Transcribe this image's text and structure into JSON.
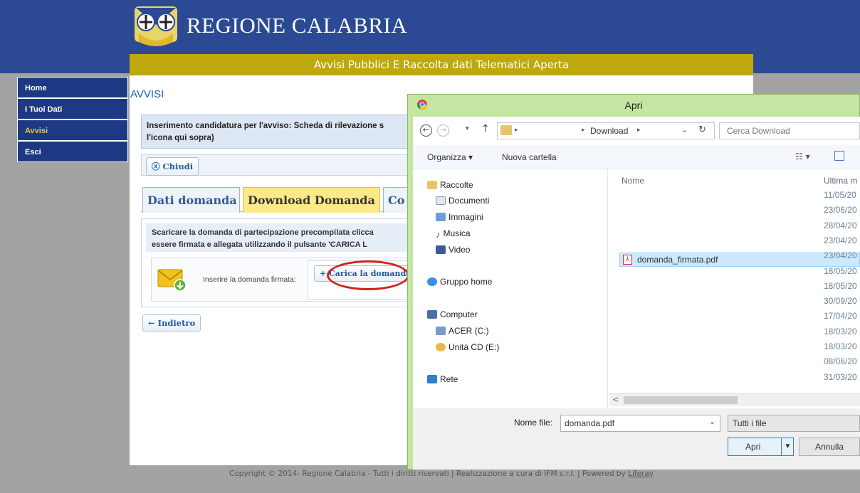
{
  "header": {
    "site_title": "REGIONE CALABRIA",
    "subtitle": "Avvisi Pubblici E Raccolta dati Telematici Aperta"
  },
  "nav": {
    "items": [
      {
        "label": "Home"
      },
      {
        "label": "I Tuoi Dati"
      },
      {
        "label": "Avvisi",
        "active": true
      },
      {
        "label": "Esci"
      }
    ]
  },
  "main": {
    "section_title": "AVVISI",
    "notice_line1": "Inserimento candidatura per l'avviso: Scheda di rilevazione s",
    "notice_line2": "l'icona qui sopra)",
    "close_label": "Chiudi",
    "tabs": [
      {
        "label": "Dati domanda"
      },
      {
        "label": "Download Domanda",
        "active": true
      },
      {
        "label": "Co"
      }
    ],
    "desc_line1": "Scaricare la domanda di partecipazione precompilata clicca",
    "desc_line2": "essere firmata e allegata utilizzando il pulsante 'CARICA L",
    "upload_label": "Inserire la domanda firmata:",
    "upload_button": "Carica la domanda",
    "back_label": "Indietro",
    "copyright": "Copyright © 2014- Regione Calabria - Tutti i diritti riservati | Realizzazione a cura di IFM s.r.l. | Powered by",
    "copyright_link": "Liferay"
  },
  "dialog": {
    "title": "Apri",
    "path_segment": "Download",
    "search_placeholder": "Cerca Download",
    "organize": "Organizza",
    "new_folder": "Nuova cartella",
    "nav_groups": [
      {
        "label": "Raccolte",
        "icon": "library-icon"
      },
      {
        "label": "Documenti",
        "icon": "documents-icon"
      },
      {
        "label": "Immagini",
        "icon": "pictures-icon"
      },
      {
        "label": "Musica",
        "icon": "music-icon"
      },
      {
        "label": "Video",
        "icon": "video-icon"
      },
      {
        "label": "Gruppo home",
        "icon": "homegroup-icon"
      },
      {
        "label": "Computer",
        "icon": "computer-icon"
      },
      {
        "label": "ACER (C:)",
        "icon": "drive-icon"
      },
      {
        "label": "Unità CD (E:)",
        "icon": "cd-drive-icon"
      },
      {
        "label": "Rete",
        "icon": "network-icon"
      }
    ],
    "col_name": "Nome",
    "col_date": "Ultima m",
    "selected_file": "domanda_firmata.pdf",
    "dates": [
      "11/05/20",
      "23/06/20",
      "28/04/20",
      "23/04/20",
      "23/04/20",
      "18/05/20",
      "18/05/20",
      "30/09/20",
      "17/04/20",
      "18/03/20",
      "18/03/20",
      "08/06/20",
      "31/03/20"
    ],
    "filename_label": "Nome file:",
    "filename_value": "domanda.pdf",
    "filetype": "Tutti i file",
    "open_button": "Apri",
    "cancel_button": "Annulla"
  },
  "colors": {
    "header_blue": "#2b4a93",
    "gold": "#bfa80e",
    "dialog_frame": "#c5e5a3",
    "annotation_red": "#d81e1e"
  }
}
